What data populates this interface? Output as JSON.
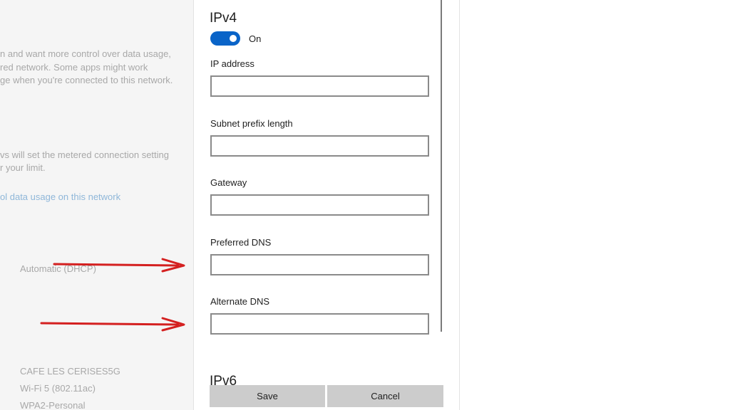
{
  "background": {
    "lines": [
      "n and want more control over data usage,",
      "red network. Some apps might work",
      "ge when you're connected to this network.",
      "vs will set the metered connection setting",
      "r your limit."
    ],
    "link": "ol data usage on this network",
    "ip_assignment": "Automatic (DHCP)",
    "ssid": "CAFE LES CERISES5G",
    "protocol": "Wi-Fi 5 (802.11ac)",
    "security": "WPA2-Personal"
  },
  "dialog": {
    "ipv4_title": "IPv4",
    "toggle_label": "On",
    "fields": {
      "ip_address": {
        "label": "IP address",
        "value": ""
      },
      "subnet": {
        "label": "Subnet prefix length",
        "value": ""
      },
      "gateway": {
        "label": "Gateway",
        "value": ""
      },
      "preferred_dns": {
        "label": "Preferred DNS",
        "value": ""
      },
      "alternate_dns": {
        "label": "Alternate DNS",
        "value": ""
      }
    },
    "ipv6_title": "IPv6",
    "save_label": "Save",
    "cancel_label": "Cancel"
  },
  "colors": {
    "toggle_on": "#0a64c8",
    "annotation": "#d42020"
  }
}
